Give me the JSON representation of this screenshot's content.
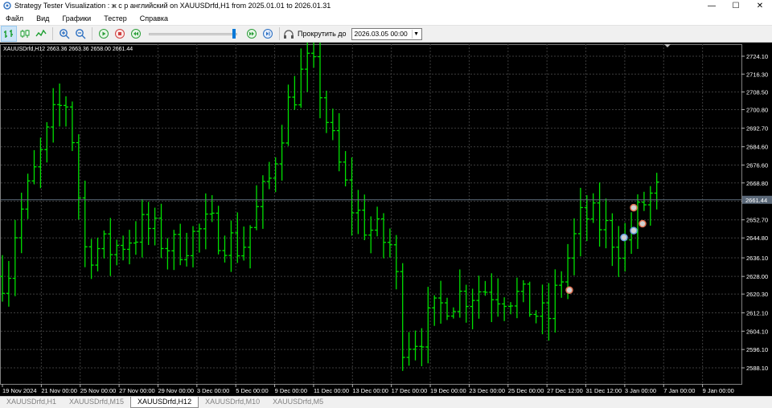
{
  "window": {
    "title": "Strategy Tester Visualization : ж с р английский on XAUUSDrfd,H1 from 2025.01.01 to 2026.01.31",
    "minimize": "—",
    "maximize": "☐",
    "close": "✕"
  },
  "menu": [
    "Файл",
    "Вид",
    "Графики",
    "Тестер",
    "Справка"
  ],
  "toolbar": {
    "icons": [
      "bar-chart-icon",
      "candlestick-icon",
      "line-chart-icon",
      "zoom-in-icon",
      "zoom-out-icon",
      "play-icon",
      "stop-icon",
      "rewind-icon",
      "fast-forward-icon",
      "step-icon"
    ],
    "speed": 0.98,
    "goto_label": "Прокрутить до",
    "goto_value": "2026.03.05 00:00"
  },
  "chart": {
    "info": "XAUUSDrfd,H12  2663.36 2663.36 2658.00 2661.44",
    "current_price": "2661.44",
    "price_ticks": [
      "2724.10",
      "2716.30",
      "2708.50",
      "2700.80",
      "2692.70",
      "2684.60",
      "2676.60",
      "2668.80",
      "2660.80",
      "2652.70",
      "2644.80",
      "2636.10",
      "2628.00",
      "2620.30",
      "2612.10",
      "2604.10",
      "2596.10",
      "2588.10"
    ],
    "time_ticks": [
      "19 Nov 2024",
      "21 Nov 00:00",
      "25 Nov 00:00",
      "27 Nov 00:00",
      "29 Nov 00:00",
      "3 Dec 00:00",
      "5 Dec 00:00",
      "9 Dec 00:00",
      "11 Dec 00:00",
      "13 Dec 00:00",
      "17 Dec 00:00",
      "19 Dec 00:00",
      "23 Dec 00:00",
      "25 Dec 00:00",
      "27 Dec 12:00",
      "31 Dec 12:00",
      "3 Jan 00:00",
      "7 Jan 00:00",
      "9 Jan 00:00"
    ],
    "colors": {
      "background": "#000000",
      "bars": "#00e000",
      "grid": "#3c3c3c",
      "price_line": "#607080",
      "axis_text": "#ffffff"
    }
  },
  "tabs": [
    "XAUUSDrfd,H1",
    "XAUUSDrfd,M15",
    "XAUUSDrfd,H12",
    "XAUUSDrfd,M10",
    "XAUUSDrfd,M5"
  ],
  "active_tab": 2
}
